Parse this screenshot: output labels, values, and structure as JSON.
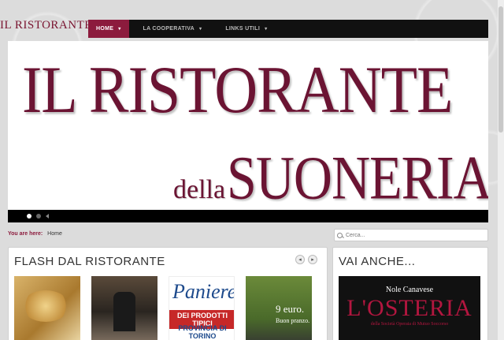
{
  "logo": "IL RISTORANTE",
  "nav": {
    "items": [
      {
        "label": "HOME",
        "caret": "▾"
      },
      {
        "label": "LA COOPERATIVA",
        "caret": "▾"
      },
      {
        "label": "LINKS UTILI",
        "caret": "▾"
      }
    ]
  },
  "banner": {
    "line1": "IL RISTORANTE",
    "line2a": "della",
    "line2b": "SUONERIA"
  },
  "breadcrumb": {
    "label": "You are here:",
    "current": "Home"
  },
  "search": {
    "placeholder": "Cerca..."
  },
  "left_panel": {
    "title": "FLASH DAL RISTORANTE",
    "prev": "◂",
    "next": "▸",
    "thumb3": {
      "line1": "Paniere",
      "line2": "DEI PRODOTTI TIPICI",
      "line3": "PROVINCIA DI TORINO"
    },
    "thumb4": {
      "line1": "9 euro.",
      "line2": "Buon pranzo."
    }
  },
  "right_panel": {
    "title": "VAI ANCHE...",
    "promo": {
      "line1": "Nole Canavese",
      "line2": "L'OSTERIA",
      "line3": "della Società Operaia di Mutuo Soccorso"
    }
  },
  "colors": {
    "brand": "#8c1b3d",
    "navbar": "#111111"
  }
}
